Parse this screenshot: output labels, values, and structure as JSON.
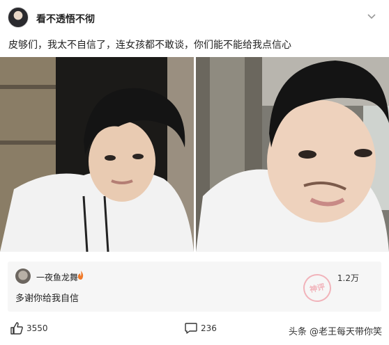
{
  "post": {
    "author": "看不透悟不彻",
    "text": "皮够们，我太不自信了，连女孩都不敢谈，你们能不能给我点信心"
  },
  "comment": {
    "author": "一夜鱼龙舞",
    "likes": "1.2万",
    "text": "多谢你给我自信",
    "stamp_text": "神评"
  },
  "footer": {
    "like_count": "3550",
    "comment_count": "236",
    "watermark": "头条 @老王每天带你笑"
  },
  "icons": {
    "more": "chevron-down-icon",
    "like": "thumbs-up-icon",
    "comment": "comment-bubble-icon",
    "badge": "flame-icon"
  },
  "colors": {
    "card_bg": "#f6f6f6",
    "flame": "#f07a2a",
    "stamp": "#f1a8b0"
  }
}
